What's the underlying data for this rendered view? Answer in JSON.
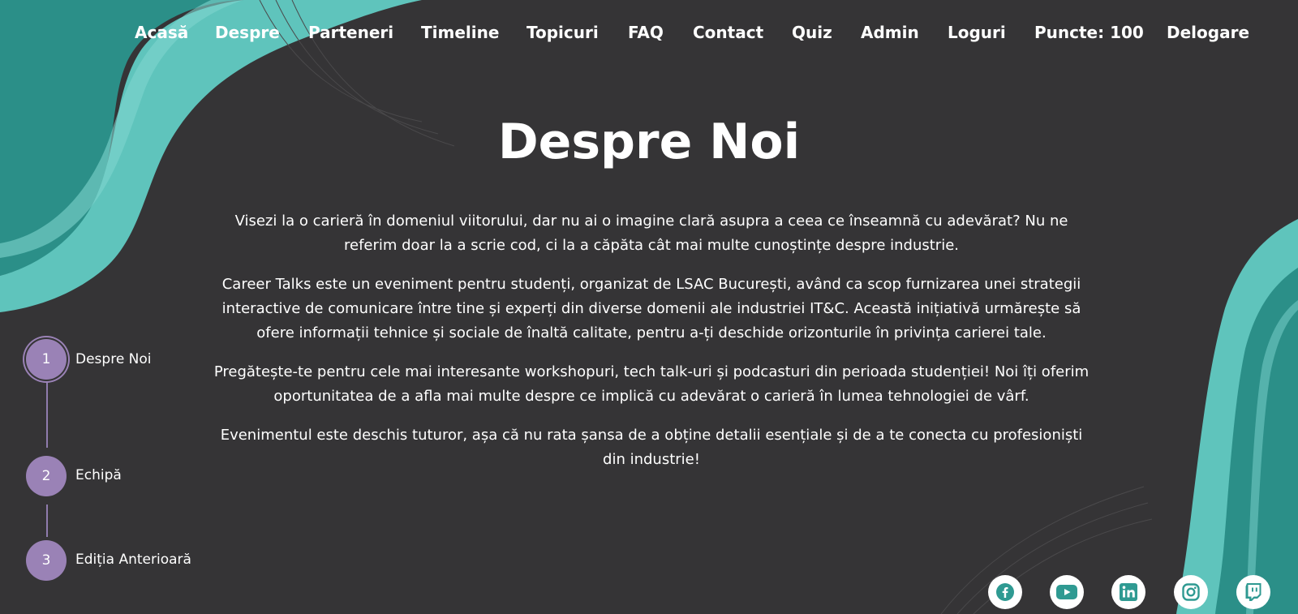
{
  "nav": {
    "items": [
      "Acasă",
      "Despre",
      "Parteneri",
      "Timeline",
      "Topicuri",
      "FAQ",
      "Contact",
      "Quiz",
      "Admin",
      "Loguri",
      "Puncte: 100",
      "Delogare"
    ]
  },
  "main": {
    "title": "Despre Noi",
    "paragraphs": [
      "Visezi la o carieră în domeniul viitorului, dar nu ai o imagine clară asupra a ceea ce înseamnă cu adevărat? Nu ne referim doar la a scrie cod, ci la a căpăta cât mai multe cunoștințe despre industrie.",
      "Career Talks este un eveniment pentru studenți, organizat de LSAC București, având ca scop furnizarea unei strategii interactive de comunicare între tine și experți din diverse domenii ale industriei IT&C. Această inițiativă urmărește să ofere informații tehnice și sociale de înaltă calitate, pentru a-ți deschide orizonturile în privința carierei tale.",
      "Pregătește-te pentru cele mai interesante workshopuri, tech talk-uri și podcasturi din perioada studenției! Noi îți oferim oportunitatea de a afla mai multe despre ce implică cu adevărat o carieră în lumea tehnologiei de vârf.",
      "Evenimentul este deschis tuturor, așa că nu rata șansa de a obține detalii esențiale și de a te conecta cu profesioniști din industrie!"
    ]
  },
  "steps": [
    {
      "number": "1",
      "label": "Despre Noi",
      "active": true
    },
    {
      "number": "2",
      "label": "Echipă",
      "active": false
    },
    {
      "number": "3",
      "label": "Ediția Anterioară",
      "active": false
    }
  ],
  "social": {
    "icons": [
      "facebook-icon",
      "youtube-icon",
      "linkedin-icon",
      "instagram-icon",
      "twitch-icon"
    ],
    "icon_color": "#2f9a92"
  },
  "colors": {
    "background": "#353436",
    "teal": "#5fc4bc",
    "teal_dark": "#2b8f88",
    "accent": "#9a82b6"
  }
}
